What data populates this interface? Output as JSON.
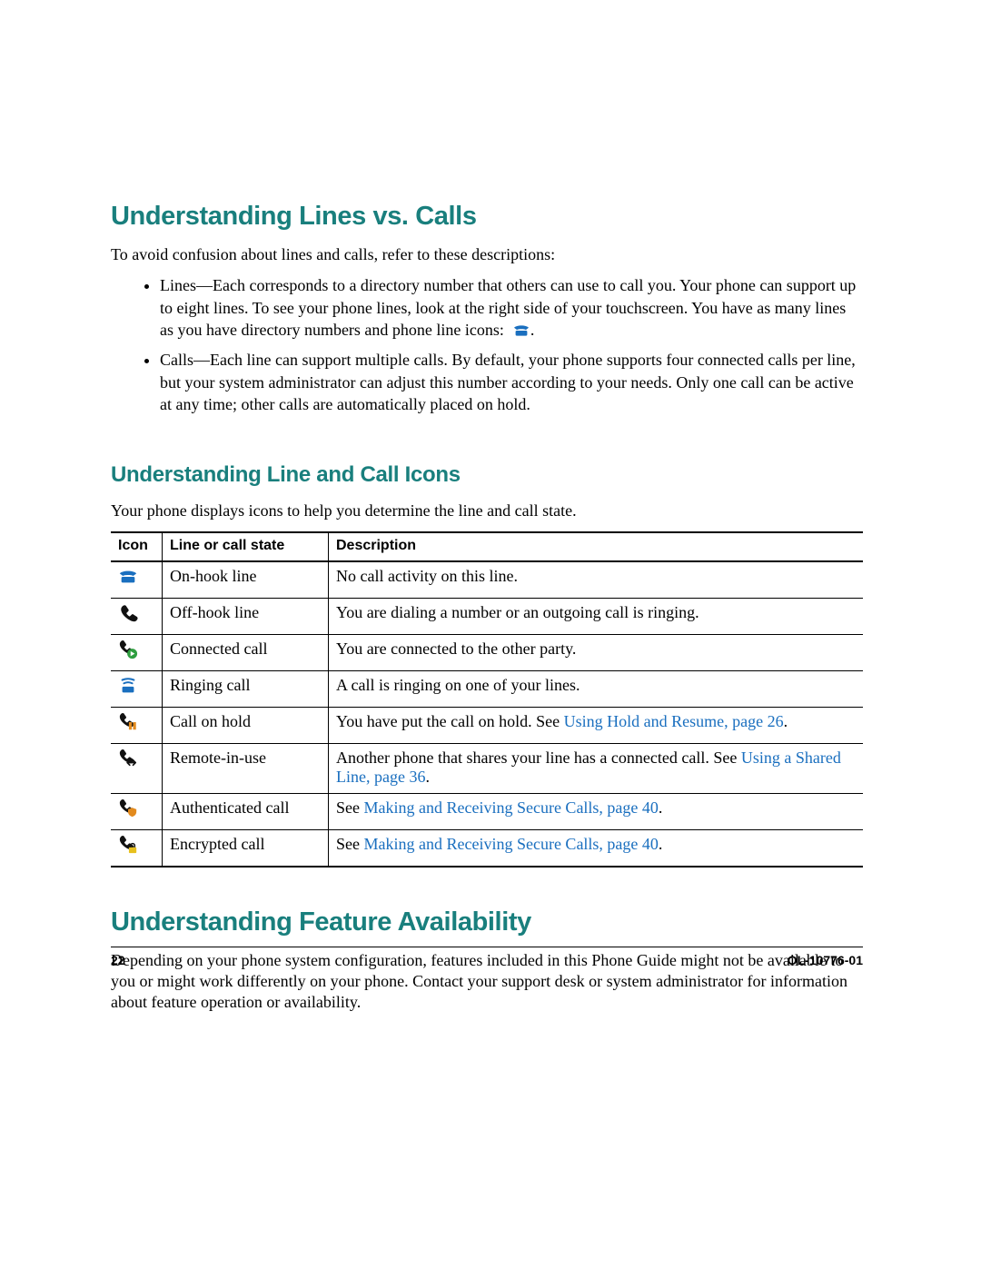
{
  "headings": {
    "h1_lines_vs_calls": "Understanding Lines vs. Calls",
    "h2_line_call_icons": "Understanding Line and Call Icons",
    "h1_feature_avail": "Understanding Feature Availability"
  },
  "intro": {
    "lines_vs_calls_intro": "To avoid confusion about lines and calls, refer to these descriptions:",
    "bullet_lines_pre": "Lines—Each corresponds to a directory number that others can use to call you. Your phone can support up to eight lines. To see your phone lines, look at the right side of your touchscreen. You have as many lines as you have directory numbers and phone line icons: ",
    "bullet_lines_post": ".",
    "bullet_calls": "Calls—Each line can support multiple calls. By default, your phone supports four connected calls per line, but your system administrator can adjust this number according to your needs. Only one call can be active at any time; other calls are automatically placed on hold.",
    "icons_intro": "Your phone displays icons to help you determine the line and call state.",
    "feature_avail_body": "Depending on your phone system configuration, features included in this Phone Guide might not be available to you or might work differently on your phone. Contact your support desk or system administrator for information about feature operation or availability."
  },
  "table": {
    "headers": {
      "icon": "Icon",
      "state": "Line or call state",
      "desc": "Description"
    },
    "rows": [
      {
        "icon": "onhook",
        "state": "On-hook line",
        "desc_pre": "No call activity on this line.",
        "link": "",
        "desc_post": ""
      },
      {
        "icon": "offhook",
        "state": "Off-hook line",
        "desc_pre": "You are dialing a number or an outgoing call is ringing.",
        "link": "",
        "desc_post": ""
      },
      {
        "icon": "connected",
        "state": "Connected call",
        "desc_pre": "You are connected to the other party.",
        "link": "",
        "desc_post": ""
      },
      {
        "icon": "ringing",
        "state": "Ringing call",
        "desc_pre": "A call is ringing on one of your lines.",
        "link": "",
        "desc_post": ""
      },
      {
        "icon": "hold",
        "state": "Call on hold",
        "desc_pre": "You have put the call on hold. See ",
        "link": "Using Hold and Resume, page 26",
        "desc_post": "."
      },
      {
        "icon": "remote",
        "state": "Remote-in-use",
        "desc_pre": "Another phone that shares your line has a connected call. See ",
        "link": "Using a Shared Line, page 36",
        "desc_post": "."
      },
      {
        "icon": "authenticated",
        "state": "Authenticated call",
        "desc_pre": "See ",
        "link": "Making and Receiving Secure Calls, page 40",
        "desc_post": "."
      },
      {
        "icon": "encrypted",
        "state": "Encrypted call",
        "desc_pre": "See ",
        "link": "Making and Receiving Secure Calls, page 40",
        "desc_post": "."
      }
    ]
  },
  "footer": {
    "page": "22",
    "docid": "OL-10776-01"
  }
}
